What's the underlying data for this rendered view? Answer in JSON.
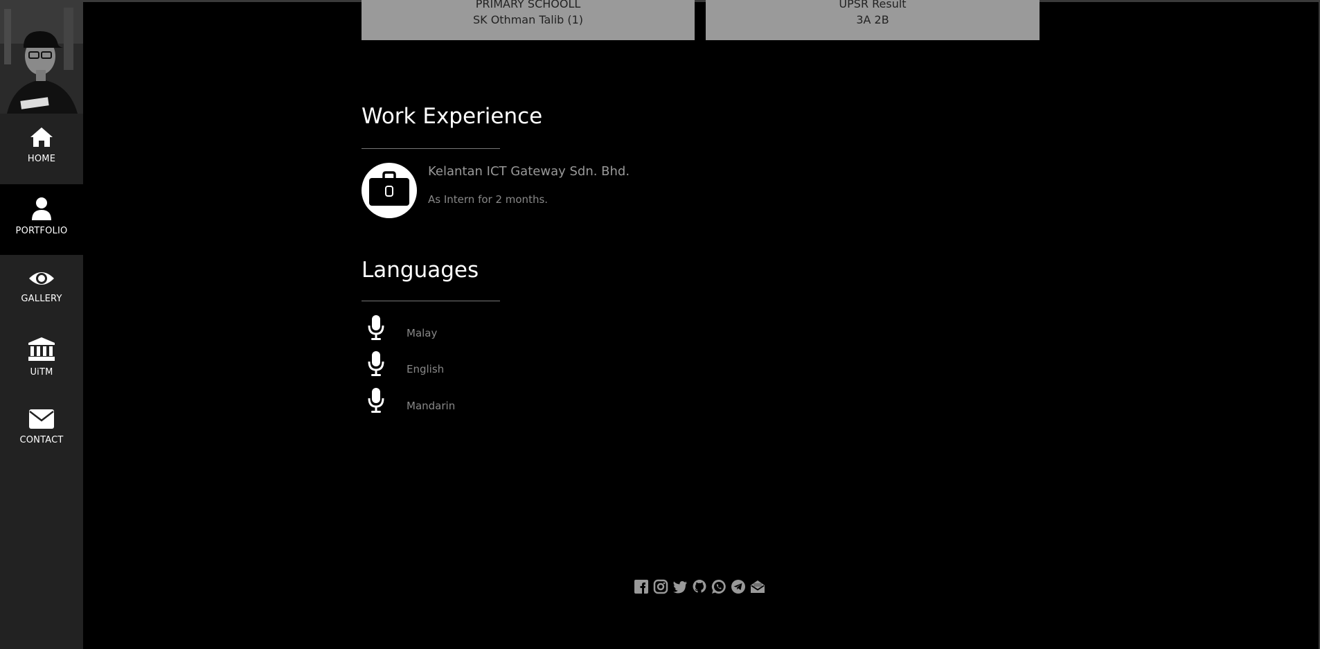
{
  "nav": {
    "items": [
      {
        "label": "HOME",
        "icon": "home-icon"
      },
      {
        "label": "PORTFOLIO",
        "icon": "user-icon"
      },
      {
        "label": "GALLERY",
        "icon": "eye-icon"
      },
      {
        "label": "UiTM",
        "icon": "university-icon"
      },
      {
        "label": "CONTACT",
        "icon": "envelope-icon"
      }
    ],
    "active": "PORTFOLIO"
  },
  "education_cards": [
    {
      "line1": "PRIMARY SCHOOLL",
      "line2": "SK Othman Talib (1)"
    },
    {
      "line1": "UPSR Result",
      "line2": "3A 2B"
    }
  ],
  "work": {
    "title": "Work Experience",
    "company": "Kelantan ICT Gateway Sdn. Bhd.",
    "role": "As Intern for 2 months.",
    "icon": "briefcase-icon"
  },
  "languages": {
    "title": "Languages",
    "items": [
      "Malay",
      "English",
      "Mandarin"
    ],
    "icon": "microphone-icon"
  },
  "social": [
    "facebook-icon",
    "instagram-icon",
    "twitter-icon",
    "github-icon",
    "whatsapp-icon",
    "telegram-icon",
    "email-open-icon"
  ],
  "colors": {
    "background": "#000000",
    "sidebar": "#222222",
    "card": "#9a9a9a",
    "muted_text": "#888888"
  }
}
